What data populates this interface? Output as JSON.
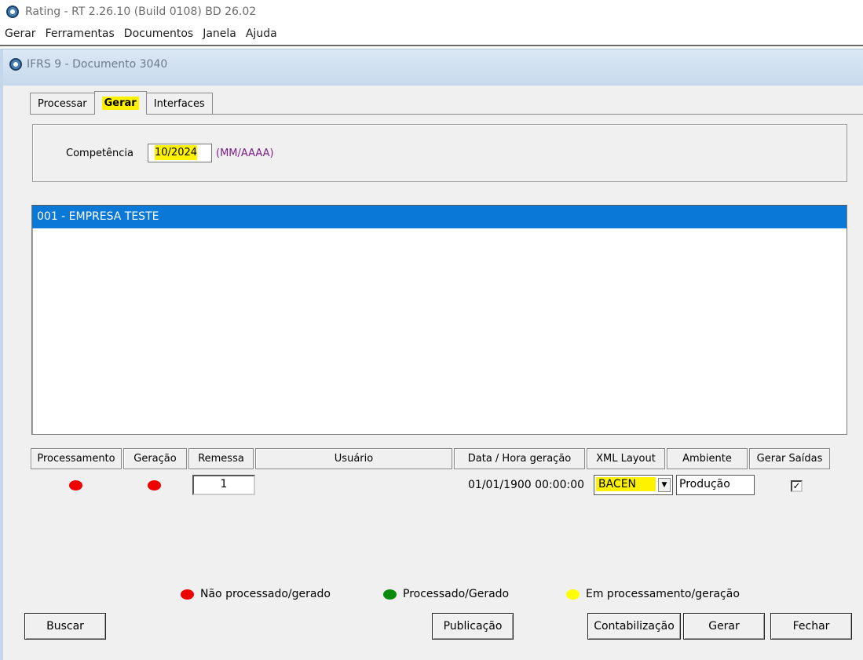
{
  "app": {
    "title": "Rating - RT 2.26.10 (Build 0108) BD 26.02"
  },
  "menu": [
    "Gerar",
    "Ferramentas",
    "Documentos",
    "Janela",
    "Ajuda"
  ],
  "window": {
    "title": "IFRS 9 - Documento 3040"
  },
  "tabs": [
    {
      "label": "Processar",
      "active": false
    },
    {
      "label": "Gerar",
      "active": true
    },
    {
      "label": "Interfaces",
      "active": false
    }
  ],
  "competencia": {
    "label": "Competência",
    "value": "10/2024",
    "hint": "(MM/AAAA)"
  },
  "companies": [
    {
      "label": "001 - EMPRESA TESTE",
      "selected": true
    }
  ],
  "grid": {
    "headers": [
      "Processamento",
      "Geração",
      "Remessa",
      "Usuário",
      "Data / Hora geração",
      "XML Layout",
      "Ambiente",
      "Gerar Saídas"
    ],
    "row": {
      "processamento_status": "red",
      "geracao_status": "red",
      "remessa": "1",
      "usuario": "",
      "data_hora": "01/01/1900 00:00:00",
      "xml_layout": "BACEN",
      "ambiente": "Produção",
      "gerar_saidas": true
    }
  },
  "legend": [
    {
      "color": "#ee0000",
      "label": "Não processado/gerado"
    },
    {
      "color": "#0a8a0a",
      "label": "Processado/Gerado"
    },
    {
      "color": "#ffff00",
      "label": "Em processamento/geração"
    }
  ],
  "buttons": {
    "buscar": "Buscar",
    "publicacao": "Publicação",
    "contabilizacao": "Contabilização",
    "gerar": "Gerar",
    "fechar": "Fechar"
  },
  "colors": {
    "highlight": "#fff200",
    "selection": "#0a78d7",
    "hint_text": "#7a1f8a"
  }
}
